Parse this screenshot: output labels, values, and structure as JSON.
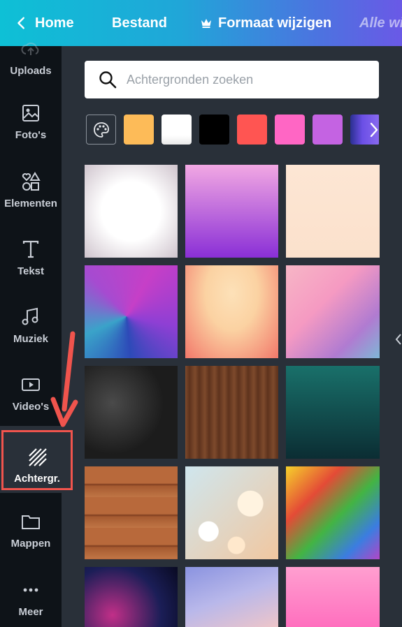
{
  "header": {
    "home_label": "Home",
    "file_label": "Bestand",
    "resize_label": "Formaat wijzigen",
    "all_changes_label": "Alle wij"
  },
  "sidebar": {
    "items": [
      {
        "label": "Uploads",
        "icon": "upload-icon"
      },
      {
        "label": "Foto's",
        "icon": "photo-icon"
      },
      {
        "label": "Elementen",
        "icon": "shapes-icon"
      },
      {
        "label": "Tekst",
        "icon": "text-icon"
      },
      {
        "label": "Muziek",
        "icon": "music-icon"
      },
      {
        "label": "Video's",
        "icon": "video-icon"
      },
      {
        "label": "Achtergr.",
        "icon": "background-stripes-icon",
        "active": true
      },
      {
        "label": "Mappen",
        "icon": "folder-icon"
      },
      {
        "label": "Meer",
        "icon": "more-dots-icon"
      }
    ]
  },
  "search": {
    "placeholder": "Achtergronden zoeken"
  },
  "colors": {
    "accent_highlight": "#f0544d",
    "sidebar_bg": "#0e1318",
    "panel_bg": "#293039",
    "swatches": [
      "#fdbb58",
      "#ffffff",
      "#000000",
      "#ff5552",
      "#ff66c4",
      "#c463e2",
      "#6b4fe6"
    ]
  },
  "backgrounds": [
    {
      "name": "white-floral-petals",
      "colors": [
        "#f4f2f3",
        "#cfc4cd"
      ]
    },
    {
      "name": "pink-purple-gradient",
      "colors": [
        "#f2a8e3",
        "#8a2fd6"
      ]
    },
    {
      "name": "peach-plain",
      "colors": [
        "#fde6d4",
        "#fbe1cc"
      ]
    },
    {
      "name": "purple-blue-polygon",
      "colors": [
        "#c63fc7",
        "#2d4ab8"
      ]
    },
    {
      "name": "peach-orange-blur",
      "colors": [
        "#fbd2a2",
        "#f2786a"
      ]
    },
    {
      "name": "pink-watercolor",
      "colors": [
        "#f59ac2",
        "#b07bd1"
      ]
    },
    {
      "name": "black-marble",
      "colors": [
        "#1c1c1c",
        "#4a4a4a"
      ]
    },
    {
      "name": "brown-wood",
      "colors": [
        "#7e4a2c",
        "#5e331d"
      ]
    },
    {
      "name": "teal-gradient",
      "colors": [
        "#19706a",
        "#0b2d33"
      ]
    },
    {
      "name": "wood-planks",
      "colors": [
        "#b8693b",
        "#7d3d1f"
      ]
    },
    {
      "name": "bokeh-lights",
      "colors": [
        "#cfe6ee",
        "#f1c7a0"
      ]
    },
    {
      "name": "rainbow-glitter",
      "colors": [
        "#f6d12b",
        "#3b7de0"
      ]
    },
    {
      "name": "galaxy",
      "colors": [
        "#1b1e57",
        "#c12f88"
      ]
    },
    {
      "name": "lavender-sky",
      "colors": [
        "#8a93e0",
        "#eec5c9"
      ]
    },
    {
      "name": "pink-gradient",
      "colors": [
        "#ff9fd0",
        "#ff6fbe"
      ]
    }
  ]
}
